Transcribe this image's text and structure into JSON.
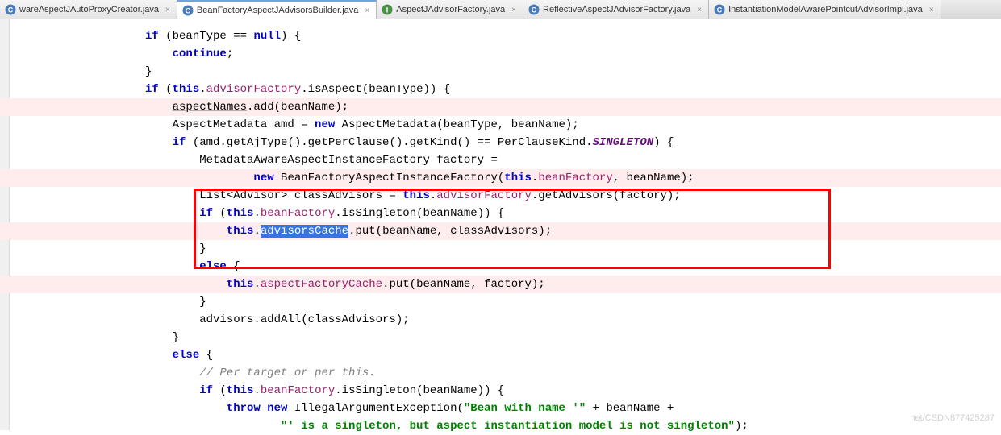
{
  "tabs": [
    {
      "label": "wareAspectJAutoProxyCreator.java",
      "active": false,
      "kind": "C"
    },
    {
      "label": "BeanFactoryAspectJAdvisorsBuilder.java",
      "active": true,
      "kind": "C"
    },
    {
      "label": "AspectJAdvisorFactory.java",
      "active": false,
      "kind": "I"
    },
    {
      "label": "ReflectiveAspectJAdvisorFactory.java",
      "active": false,
      "kind": "C"
    },
    {
      "label": "InstantiationModelAwarePointcutAdvisorImpl.java",
      "active": false,
      "kind": "C"
    }
  ],
  "code": {
    "l01a": "if (beanType == ",
    "l01b": "null",
    "l01c": ") {",
    "l02": "    continue;",
    "l03": "}",
    "l04a": "if (",
    "l04b": "this",
    "l04c": ".",
    "l04d": "advisorFactory",
    "l04e": ".isAspect(beanType)) {",
    "l05a": "    ",
    "l05b": "aspectNames",
    "l05c": ".add(beanName);",
    "l06a": "    AspectMetadata amd = ",
    "l06b": "new",
    "l06c": " AspectMetadata(beanType, beanName);",
    "l07a": "    if (amd.getAjType().getPerClause().getKind() == PerClauseKind.",
    "l07b": "SINGLETON",
    "l07c": ") {",
    "l08": "        MetadataAwareAspectInstanceFactory factory =",
    "l09a": "                ",
    "l09b": "new",
    "l09c": " BeanFactoryAspectInstanceFactory(",
    "l09d": "this",
    "l09e": ".",
    "l09f": "beanFactory",
    "l09g": ", beanName);",
    "l10a": "        List<Advisor> classAdvisors = ",
    "l10b": "this",
    "l10c": ".",
    "l10d": "advisorFactory",
    "l10e": ".getAdvisors(factory);",
    "l11a": "        if (",
    "l11b": "this",
    "l11c": ".",
    "l11d": "beanFactory",
    "l11e": ".isSingleton(beanName)) {",
    "l12a": "            ",
    "l12b": "this",
    "l12c": ".",
    "l12d": "advisorsCache",
    "l12e": ".put(beanName, classAdvisors);",
    "l13": "        }",
    "l14a": "        ",
    "l14b": "else",
    "l14c": " {",
    "l15a": "            ",
    "l15b": "this",
    "l15c": ".",
    "l15d": "aspectFactoryCache",
    "l15e": ".put(beanName, factory);",
    "l16": "        }",
    "l17": "        advisors.addAll(classAdvisors);",
    "l18": "    }",
    "l19a": "    ",
    "l19b": "else",
    "l19c": " {",
    "l20": "        // Per target or per this.",
    "l21a": "        if (",
    "l21b": "this",
    "l21c": ".",
    "l21d": "beanFactory",
    "l21e": ".isSingleton(beanName)) {",
    "l22a": "            ",
    "l22b": "throw new",
    "l22c": " IllegalArgumentException(",
    "l22d": "\"Bean with name '\"",
    "l22e": " + beanName +",
    "l23a": "                    ",
    "l23b": "\"' is a singleton, but aspect instantiation model is not singleton\"",
    "l23c": ");"
  },
  "watermark": "net/CSDN877425287"
}
